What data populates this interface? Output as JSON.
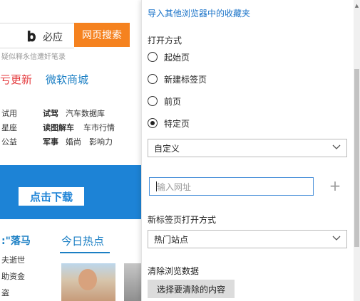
{
  "background_page": {
    "search_brand": "必应",
    "search_button": "网页搜索",
    "search_hint": "疑似释永信遭奸笔录",
    "nav": [
      "亏更新",
      "微软商城"
    ],
    "grid": [
      [
        "试用",
        "试驾",
        "汽车数据库"
      ],
      [
        "星座",
        "读图解车",
        "车市行情"
      ],
      [
        "公益",
        "军事",
        "婚尚",
        "影响力"
      ]
    ],
    "download_button": "点击下载",
    "news_heading_partial": ":\"落马",
    "news_heading": "今日热点",
    "news_items": [
      "夫逝世",
      "助资金",
      "盗"
    ]
  },
  "panel": {
    "import_link": "导入其他浏览器中的收藏夹",
    "open_with_label": "打开方式",
    "open_options": [
      {
        "label": "起始页",
        "checked": false
      },
      {
        "label": "新建标签页",
        "checked": false
      },
      {
        "label": "前页",
        "checked": false
      },
      {
        "label": "特定页",
        "checked": true
      }
    ],
    "custom_select": "自定义",
    "url_placeholder": "输入网址",
    "add_symbol": "+",
    "new_tab_label": "新标签页打开方式",
    "new_tab_select": "热门站点",
    "clear_label": "清除浏览数据",
    "clear_button": "选择要清除的内容"
  },
  "colors": {
    "accent": "#1a73c8",
    "search_orange": "#f5821f",
    "banner_blue": "#1d83d6",
    "nav_red": "#e4393c"
  }
}
